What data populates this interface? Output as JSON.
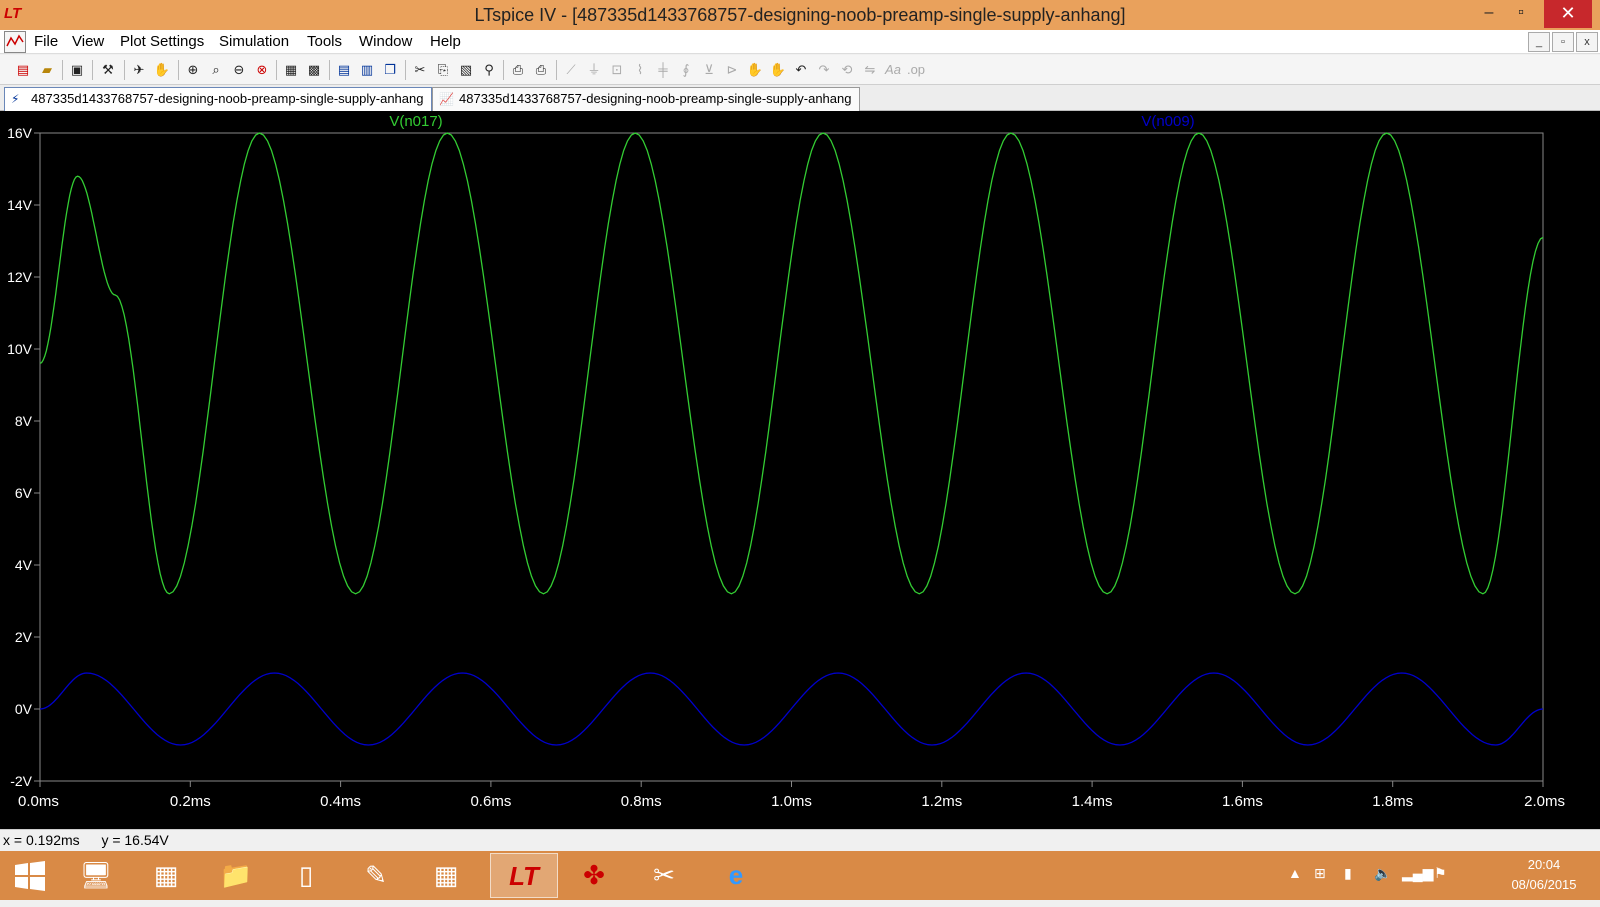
{
  "window": {
    "title": "LTspice IV - [487335d1433768757-designing-noob-preamp-single-supply-anhang]",
    "minimize": "–",
    "maximize": "▫",
    "close": "✕"
  },
  "menu": {
    "items": [
      "File",
      "View",
      "Plot Settings",
      "Simulation",
      "Tools",
      "Window",
      "Help"
    ]
  },
  "tabs": [
    {
      "label": "487335d1433768757-designing-noob-preamp-single-supply-anhang",
      "icon": "schematic-icon"
    },
    {
      "label": "487335d1433768757-designing-noob-preamp-single-supply-anhang",
      "icon": "waveform-icon"
    }
  ],
  "status": {
    "x_readout": "x = 0.192ms",
    "y_readout": "y = 16.54V"
  },
  "taskbar": {
    "clock_time": "20:04",
    "clock_date": "08/06/2015"
  },
  "chart_data": {
    "type": "line",
    "x_unit": "ms",
    "y_unit": "V",
    "xlim": [
      0,
      2.0
    ],
    "ylim": [
      -2,
      16
    ],
    "x_ticks": [
      "0.0ms",
      "0.2ms",
      "0.4ms",
      "0.6ms",
      "0.8ms",
      "1.0ms",
      "1.2ms",
      "1.4ms",
      "1.6ms",
      "1.8ms",
      "2.0ms"
    ],
    "y_ticks": [
      "16V",
      "14V",
      "12V",
      "10V",
      "8V",
      "6V",
      "4V",
      "2V",
      "0V",
      "-2V"
    ],
    "background": "#000000",
    "series": [
      {
        "name": "V(n017)",
        "color": "#33cc33",
        "x": [
          0.0,
          0.05,
          0.1,
          0.172,
          0.292,
          0.42,
          0.542,
          0.67,
          0.792,
          0.92,
          1.042,
          1.17,
          1.292,
          1.42,
          1.542,
          1.67,
          1.792,
          1.92,
          2.0
        ],
        "values": [
          9.6,
          14.8,
          11.5,
          3.2,
          16.0,
          3.2,
          16.0,
          3.2,
          16.0,
          3.2,
          16.0,
          3.2,
          16.0,
          3.2,
          16.0,
          3.2,
          16.0,
          3.2,
          13.1
        ]
      },
      {
        "name": "V(n009)",
        "color": "#0000cc",
        "x": [
          0.0,
          0.062,
          0.187,
          0.312,
          0.437,
          0.562,
          0.687,
          0.812,
          0.937,
          1.062,
          1.187,
          1.312,
          1.437,
          1.562,
          1.687,
          1.812,
          1.937,
          2.0
        ],
        "values": [
          0.0,
          1.0,
          -1.0,
          1.0,
          -1.0,
          1.0,
          -1.0,
          1.0,
          -1.0,
          1.0,
          -1.0,
          1.0,
          -1.0,
          1.0,
          -1.0,
          1.0,
          -1.0,
          0.0
        ]
      }
    ]
  }
}
